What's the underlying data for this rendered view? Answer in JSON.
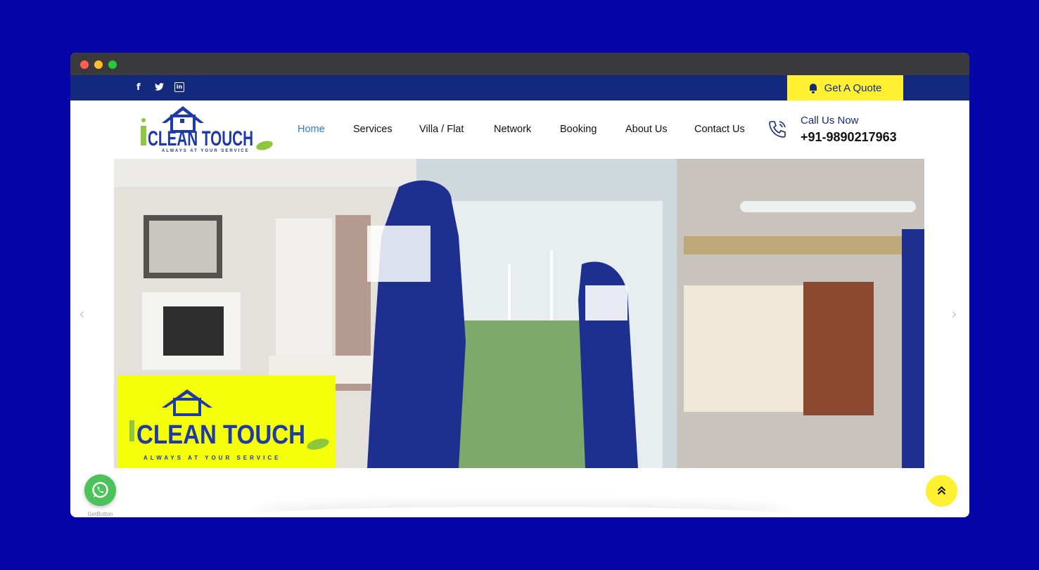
{
  "colors": {
    "page_background": "#0505a8",
    "topbar": "#13297e",
    "accent_yellow": "#fff132",
    "nav_active": "#2e7ad6",
    "whatsapp_green": "#4cc35a"
  },
  "topbar": {
    "social_icons": [
      "facebook-icon",
      "twitter-icon",
      "linkedin-icon"
    ],
    "quote_button": {
      "label": "Get A Quote",
      "icon": "bell-icon"
    }
  },
  "logo": {
    "text": "CLEAN TOUCH",
    "tagline": "ALWAYS AT YOUR SERVICE"
  },
  "nav": {
    "items": [
      "Home",
      "Services",
      "Villa / Flat",
      "Network",
      "Booking",
      "About Us",
      "Contact Us"
    ],
    "active": "Home"
  },
  "contact": {
    "label": "Call Us Now",
    "phone": "+91-9890217963",
    "icon": "phone-icon"
  },
  "hero": {
    "logo_text": "CLEAN TOUCH",
    "logo_tagline": "ALWAYS AT YOUR SERVICE",
    "prev_icon": "chevron-left-icon",
    "next_icon": "chevron-right-icon"
  },
  "floating": {
    "whatsapp_label": "GetButton",
    "whatsapp_icon": "whatsapp-icon",
    "scroll_top_icon": "double-chevron-up-icon"
  }
}
